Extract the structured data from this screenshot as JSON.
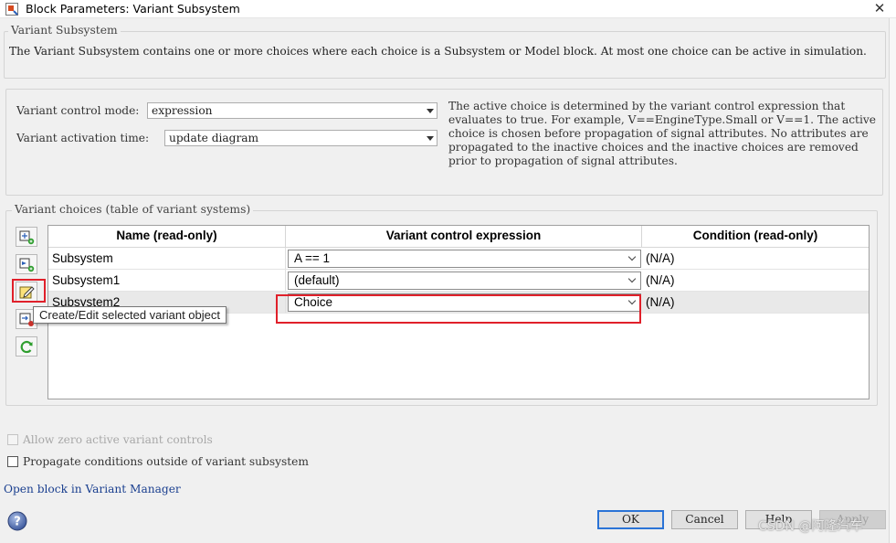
{
  "window": {
    "title": "Block Parameters: Variant Subsystem",
    "close_glyph": "✕"
  },
  "description": {
    "legend": "Variant Subsystem",
    "text": "The Variant Subsystem contains one or more choices where each choice is a Subsystem or Model block. At most one choice can be active in simulation."
  },
  "control": {
    "mode_label": "Variant control mode:",
    "mode_value": "expression",
    "activation_label": "Variant activation time:",
    "activation_value": "update diagram",
    "info": "The active choice is determined by the variant control expression that evaluates to true. For example, V==EngineType.Small or V==1. The active choice is chosen before propagation of signal attributes. No attributes are propagated to the inactive choices and the inactive choices are removed prior to propagation of signal attributes."
  },
  "choices": {
    "legend": "Variant choices (table of variant systems)",
    "columns": [
      "Name (read-only)",
      "Variant control expression",
      "Condition (read-only)"
    ],
    "rows": [
      {
        "name": "Subsystem",
        "expression": "A == 1",
        "condition": "(N/A)"
      },
      {
        "name": "Subsystem1",
        "expression": "(default)",
        "condition": "(N/A)"
      },
      {
        "name": "Subsystem2",
        "expression": "Choice",
        "condition": "(N/A)"
      }
    ],
    "side_buttons": [
      "add-subsystem-icon",
      "add-model-icon",
      "edit-variant-object-icon",
      "open-block-icon",
      "refresh-icon"
    ],
    "tooltip": "Create/Edit selected variant object"
  },
  "options": {
    "allow_zero": "Allow zero active variant controls",
    "propagate": "Propagate conditions outside of variant subsystem"
  },
  "link": "Open block in Variant Manager",
  "buttons": {
    "ok": "OK",
    "cancel": "Cancel",
    "help": "Help",
    "apply": "Apply"
  },
  "watermark": "CSDN @阿隆汽车",
  "colors": {
    "highlight": "#e0202a",
    "link": "#1a3f8f",
    "ok_border": "#2a73d6"
  }
}
